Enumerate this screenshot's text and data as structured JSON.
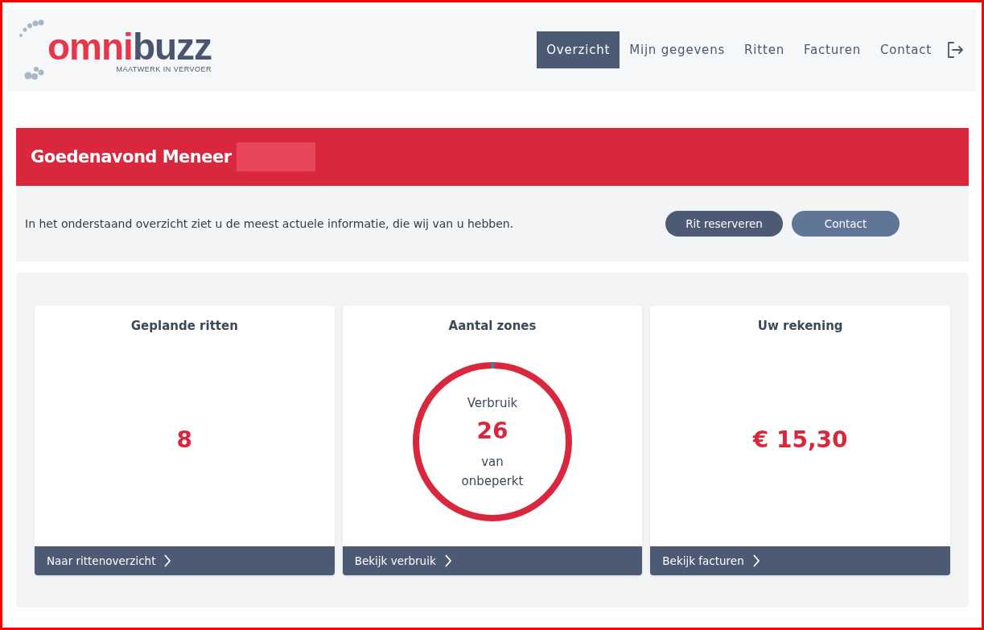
{
  "logo": {
    "brand_part_1": "omni",
    "brand_part_2": "buzz",
    "tagline": "MAATWERK IN VERVOER"
  },
  "nav": [
    {
      "label": "Overzicht",
      "selected": true
    },
    {
      "label": "Mijn gegevens",
      "selected": false
    },
    {
      "label": "Ritten",
      "selected": false
    },
    {
      "label": "Facturen",
      "selected": false
    },
    {
      "label": "Contact",
      "selected": false
    }
  ],
  "banner": {
    "greeting": "Goedenavond Meneer",
    "name_redacted": true
  },
  "info": {
    "text": "In het onderstaand overzicht ziet u de meest actuele informatie, die wij van u hebben.",
    "buttons": [
      {
        "label": "Rit reserveren",
        "kind": "primary"
      },
      {
        "label": "Contact",
        "kind": "secondary"
      }
    ]
  },
  "cards": [
    {
      "kind": "number",
      "title": "Geplande ritten",
      "value": "8",
      "link": "Naar rittenoverzicht"
    },
    {
      "kind": "ring",
      "title": "Aantal zones",
      "caption_top": "Verbruik",
      "value": "26",
      "caption_bottom": "van onbeperkt",
      "link": "Bekijk verbruik"
    },
    {
      "kind": "number",
      "title": "Uw rekening",
      "value": "€ 15,30",
      "link": "Bekijk facturen"
    }
  ]
}
